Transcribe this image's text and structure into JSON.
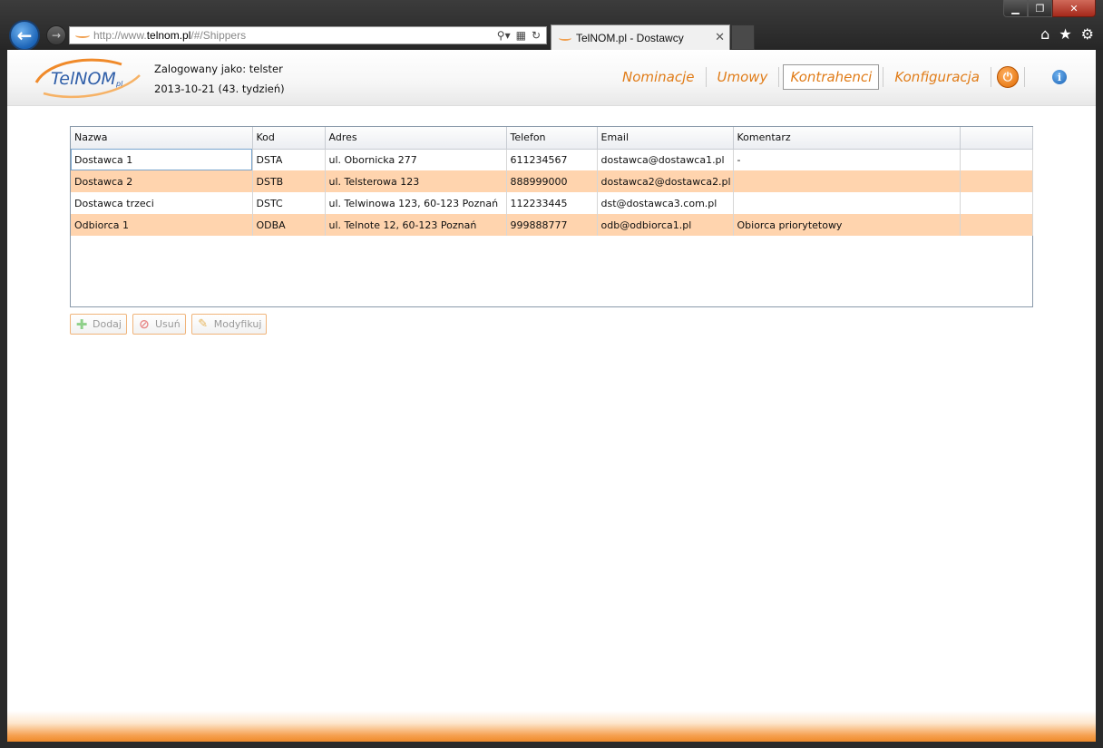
{
  "browser": {
    "url_prefix": "http://www.",
    "url_host": "telnom.pl",
    "url_path": "/#/Shippers",
    "tab_title": "TelNOM.pl - Dostawcy",
    "window_controls": [
      "▁",
      "❐",
      "✕"
    ]
  },
  "header": {
    "logo_text": "TelNOM",
    "logo_suffix": "pl",
    "logged_in_label": "Zalogowany jako: telster",
    "date_label": "2013-10-21 (43. tydzień)"
  },
  "nav": {
    "items": [
      "Nominacje",
      "Umowy",
      "Kontrahenci",
      "Konfiguracja"
    ],
    "active": "Kontrahenci"
  },
  "grid": {
    "columns": [
      "Nazwa",
      "Kod",
      "Adres",
      "Telefon",
      "Email",
      "Komentarz"
    ],
    "rows": [
      [
        "Dostawca 1",
        "DSTA",
        "ul. Obornicka 277",
        "611234567",
        "dostawca@dostawca1.pl",
        "-"
      ],
      [
        "Dostawca 2",
        "DSTB",
        "ul. Telsterowa 123",
        "888999000",
        "dostawca2@dostawca2.pl",
        ""
      ],
      [
        "Dostawca trzeci",
        "DSTC",
        "ul. Telwinowa 123, 60-123 Poznań",
        "112233445",
        "dst@dostawca3.com.pl",
        ""
      ],
      [
        "Odbiorca 1",
        "ODBA",
        "ul. Telnote 12, 60-123 Poznań",
        "999888777",
        "odb@odbiorca1.pl",
        "Obiorca priorytetowy"
      ]
    ]
  },
  "actions": {
    "add": "Dodaj",
    "delete": "Usuń",
    "modify": "Modyfikuj"
  },
  "colors": {
    "accent": "#e07c18",
    "row_alt": "#ffd4ae",
    "footer": "#ef8a2a"
  }
}
